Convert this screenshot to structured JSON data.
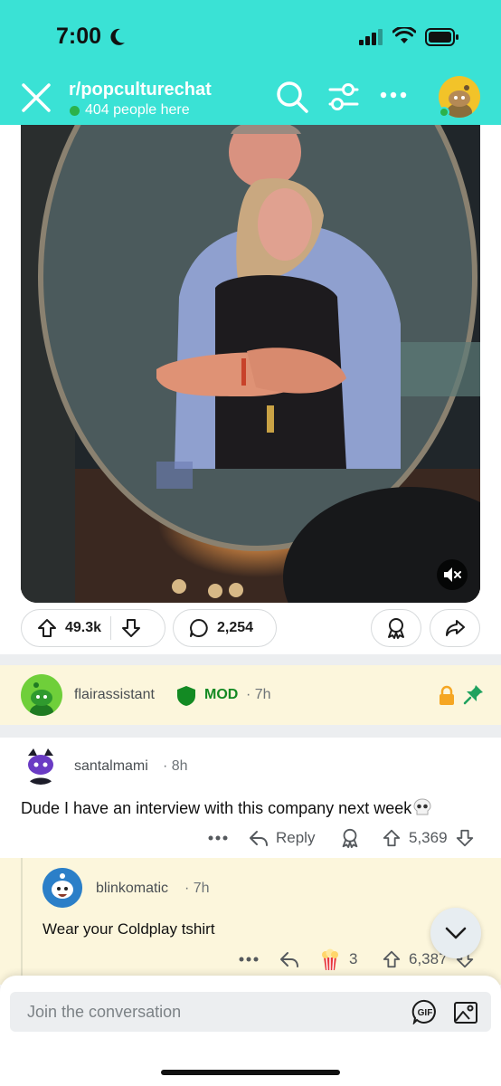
{
  "status_bar": {
    "time": "7:00"
  },
  "header": {
    "subreddit": "r/popculturechat",
    "online_text": "404 people here",
    "colors": {
      "bar": "#3ae2d5",
      "online_dot": "#2bb24c"
    }
  },
  "post": {
    "media_alt": "Concert jumbotron showing a couple embracing",
    "upvotes": "49.3k",
    "comments": "2,254"
  },
  "pinned_comment": {
    "username": "flairassistant",
    "badge": "MOD",
    "time": "7h"
  },
  "comment": {
    "username": "santalmami",
    "time": "8h",
    "body": "Dude I have an interview with this company next week",
    "reply_label": "Reply",
    "score": "5,369"
  },
  "reply": {
    "username": "blinkomatic",
    "time": "7h",
    "body": "Wear your Coldplay tshirt",
    "award_count": "3",
    "score": "6,387"
  },
  "composer": {
    "placeholder": "Join the conversation"
  }
}
